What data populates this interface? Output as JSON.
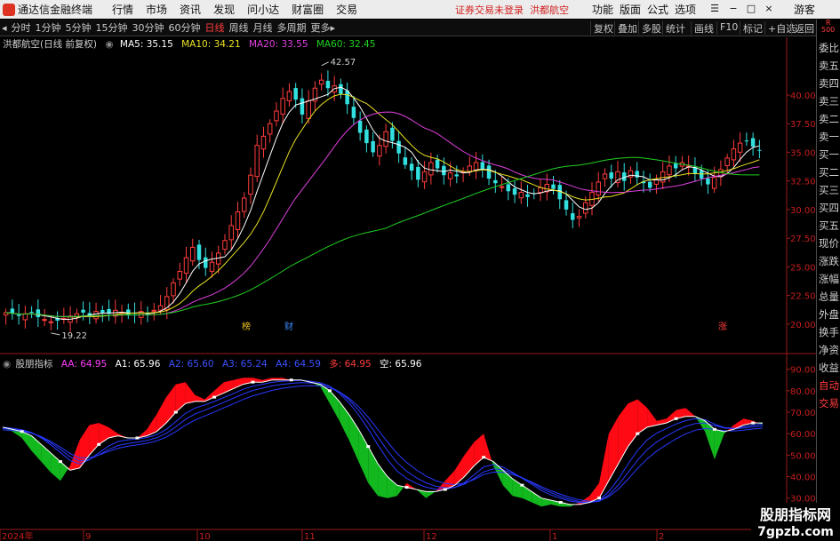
{
  "menubar": {
    "app_title": "通达信金融终端",
    "items": [
      "行情",
      "市场",
      "资讯",
      "发现",
      "问小达",
      "财富圈",
      "交易"
    ],
    "notice": "证券交易未登录",
    "stock_name": "洪都航空",
    "right_items": [
      "功能",
      "版面",
      "公式",
      "选项"
    ],
    "user": "游客"
  },
  "toolbar": {
    "timeframes": [
      "分时",
      "1分钟",
      "5分钟",
      "15分钟",
      "30分钟",
      "60分钟",
      "日线",
      "周线",
      "月线",
      "多周期",
      "更多"
    ],
    "active_timeframe": "日线",
    "right_tools": [
      "复权",
      "叠加",
      "多股",
      "统计",
      "画线",
      "F10",
      "标记",
      "+自选",
      "返回"
    ]
  },
  "main_header": {
    "title": "洪都航空(日线 前复权)",
    "ma5": "MA5: 35.15",
    "ma10": "MA10: 34.21",
    "ma20": "MA20: 33.55",
    "ma60": "MA60: 32.45"
  },
  "sub_header": {
    "title": "股朋指标",
    "aa": "AA: 64.95",
    "a1": "A1: 65.96",
    "a2": "A2: 65.60",
    "a3": "A3: 65.24",
    "a4": "A4: 64.59",
    "duo": "多: 64.95",
    "kong": "空: 65.96"
  },
  "right_tabs": [
    "委比",
    "卖五",
    "卖四",
    "卖三",
    "卖二",
    "卖一",
    "买一",
    "买二",
    "买三",
    "买四",
    "买五",
    "现价",
    "涨跌",
    "涨幅",
    "总量",
    "外盘",
    "换手",
    "净资",
    "收益",
    "自动",
    "交易"
  ],
  "right_corner": {
    "r": "R",
    "v": "500"
  },
  "markers": {
    "bang": "榜",
    "cai": "财",
    "zhang": "涨"
  },
  "annotations": {
    "high": "42.57",
    "low": "19.22"
  },
  "colors": {
    "up": "#ff3c3c",
    "down": "#33e0e0",
    "ma5": "#ffffff",
    "ma10": "#e8e020",
    "ma20": "#e040e0",
    "ma60": "#20d020",
    "fill_red": "#ff0a14",
    "fill_green": "#12b81e"
  },
  "chart_data": [
    {
      "type": "line",
      "title": "洪都航空(日线 前复权)",
      "y_ticks": [
        "40.00",
        "37.50",
        "35.00",
        "32.50",
        "30.00",
        "27.50",
        "25.00",
        "22.50",
        "20.00"
      ],
      "ylim": [
        18.2,
        43.8
      ],
      "x_ticks": [
        "2024年",
        "9",
        "10",
        "11",
        "12",
        "1",
        "2"
      ],
      "series_close": [
        21.0,
        20.9,
        20.7,
        20.9,
        21.0,
        20.6,
        20.4,
        20.2,
        20.3,
        20.5,
        20.7,
        20.9,
        21.0,
        20.8,
        21.1,
        21.0,
        20.9,
        21.2,
        21.0,
        20.8,
        20.9,
        21.1,
        20.8,
        21.2,
        21.6,
        22.4,
        23.6,
        24.6,
        25.8,
        26.7,
        25.6,
        24.9,
        25.4,
        26.2,
        27.3,
        28.6,
        29.8,
        31.0,
        33.0,
        35.6,
        36.4,
        37.5,
        38.6,
        39.7,
        40.3,
        39.6,
        38.3,
        39.5,
        40.6,
        41.3,
        40.6,
        40.8,
        40.1,
        39.2,
        38.0,
        36.7,
        35.8,
        35.0,
        35.6,
        36.8,
        36.0,
        34.9,
        33.9,
        33.4,
        32.6,
        33.3,
        34.1,
        33.6,
        33.0,
        33.2,
        32.9,
        33.3,
        33.8,
        34.1,
        33.5,
        32.7,
        32.3,
        32.0,
        31.6,
        31.3,
        31.5,
        31.1,
        31.4,
        31.9,
        32.2,
        31.8,
        30.9,
        30.0,
        29.1,
        29.4,
        30.6,
        31.5,
        32.4,
        33.1,
        32.7,
        33.3,
        32.5,
        33.4,
        32.8,
        32.3,
        31.9,
        32.6,
        33.3,
        33.8,
        33.6,
        34.1,
        33.8,
        33.1,
        32.7,
        32.2,
        32.8,
        33.5,
        34.5,
        35.3,
        35.8,
        36.0,
        35.5,
        35.2
      ],
      "ma5": 35.15,
      "ma10": 34.21,
      "ma20": 33.55,
      "ma60": 32.45,
      "high": 42.57,
      "low": 19.22
    },
    {
      "type": "area",
      "title": "股朋指标",
      "y_ticks": [
        "90.00",
        "80.00",
        "70.00",
        "60.00",
        "50.00",
        "40.00",
        "30.00"
      ],
      "ylim": [
        22,
        94
      ],
      "series": [
        {
          "name": "AA",
          "values": [
            63,
            61,
            58,
            52,
            47,
            42,
            38,
            45,
            57,
            64,
            65,
            63,
            60,
            58,
            58,
            62,
            69,
            77,
            83,
            84,
            78,
            76,
            80,
            84,
            85,
            86,
            86,
            85,
            86,
            86,
            85,
            85,
            84,
            82,
            74,
            66,
            57,
            47,
            37,
            31,
            30,
            31,
            37,
            34,
            30,
            33,
            38,
            43,
            50,
            56,
            60,
            45,
            36,
            31,
            30,
            28,
            26,
            27,
            26,
            26,
            28,
            31,
            37,
            60,
            68,
            74,
            76,
            72,
            66,
            67,
            71,
            72,
            68,
            61,
            48,
            60,
            64,
            67,
            66,
            64
          ]
        },
        {
          "name": "A1",
          "values": [
            63,
            62,
            61,
            59,
            55,
            51,
            47,
            43,
            44,
            50,
            55,
            58,
            59,
            58,
            58,
            59,
            61,
            65,
            70,
            74,
            75,
            75,
            77,
            79,
            81,
            83,
            84,
            84,
            85,
            85,
            85,
            85,
            84,
            83,
            80,
            75,
            69,
            62,
            54,
            46,
            40,
            36,
            35,
            34,
            33,
            33,
            34,
            36,
            40,
            45,
            49,
            47,
            43,
            39,
            36,
            33,
            30,
            29,
            28,
            27,
            27,
            28,
            30,
            38,
            46,
            54,
            60,
            63,
            64,
            65,
            67,
            68,
            68,
            66,
            62,
            61,
            62,
            64,
            65,
            65
          ]
        }
      ]
    }
  ]
}
